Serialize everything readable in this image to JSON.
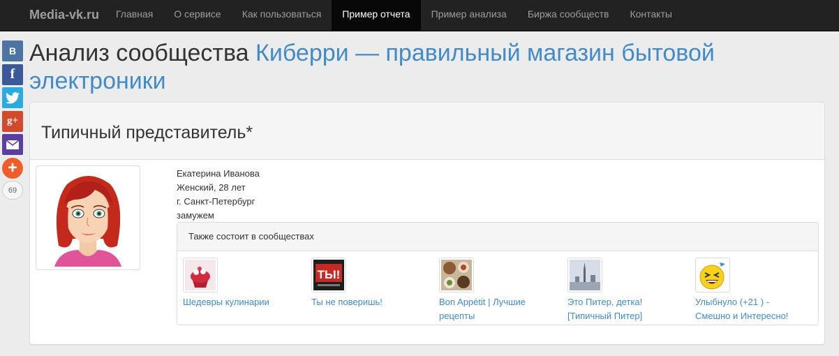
{
  "navbar": {
    "brand": "Media-vk.ru",
    "items": [
      {
        "label": "Главная",
        "active": false
      },
      {
        "label": "О сервисе",
        "active": false
      },
      {
        "label": "Как пользоваться",
        "active": false
      },
      {
        "label": "Пример отчета",
        "active": true
      },
      {
        "label": "Пример анализа",
        "active": false
      },
      {
        "label": "Биржа сообществ",
        "active": false
      },
      {
        "label": "Контакты",
        "active": false
      }
    ]
  },
  "social": {
    "vk": "В",
    "fb": "f",
    "gp": "g+",
    "plus": "+",
    "count": "69"
  },
  "page": {
    "title_prefix": "Анализ сообщества ",
    "title_link": "Киберри — правильный магазин бытовой электроники"
  },
  "panel": {
    "heading": "Типичный представитель*",
    "person": {
      "name": "Екатерина Иванова",
      "gender_age": "Женский, 28 лет",
      "city": "г. Санкт-Петербург",
      "status": "замужем"
    },
    "communities": {
      "heading": "Также состоит в сообществах",
      "items": [
        {
          "line1": "Шедевры кулинарии",
          "line2": ""
        },
        {
          "line1": "Ты не поверишь!",
          "line2": ""
        },
        {
          "line1": "Bon Appétit | Лучшие",
          "line2": "рецепты"
        },
        {
          "line1": "Это Питер, детка!",
          "line2": "[Типичный Питер]"
        },
        {
          "line1": "Улыбнуло (+21 ) -",
          "line2": "Смешно и Интересно!"
        }
      ],
      "thumb_text_2": "ТЫ!"
    }
  },
  "colors": {
    "navbar_bg": "#222222",
    "navbar_active_bg": "#080808",
    "link": "#428bca",
    "page_bg": "#ececec"
  }
}
